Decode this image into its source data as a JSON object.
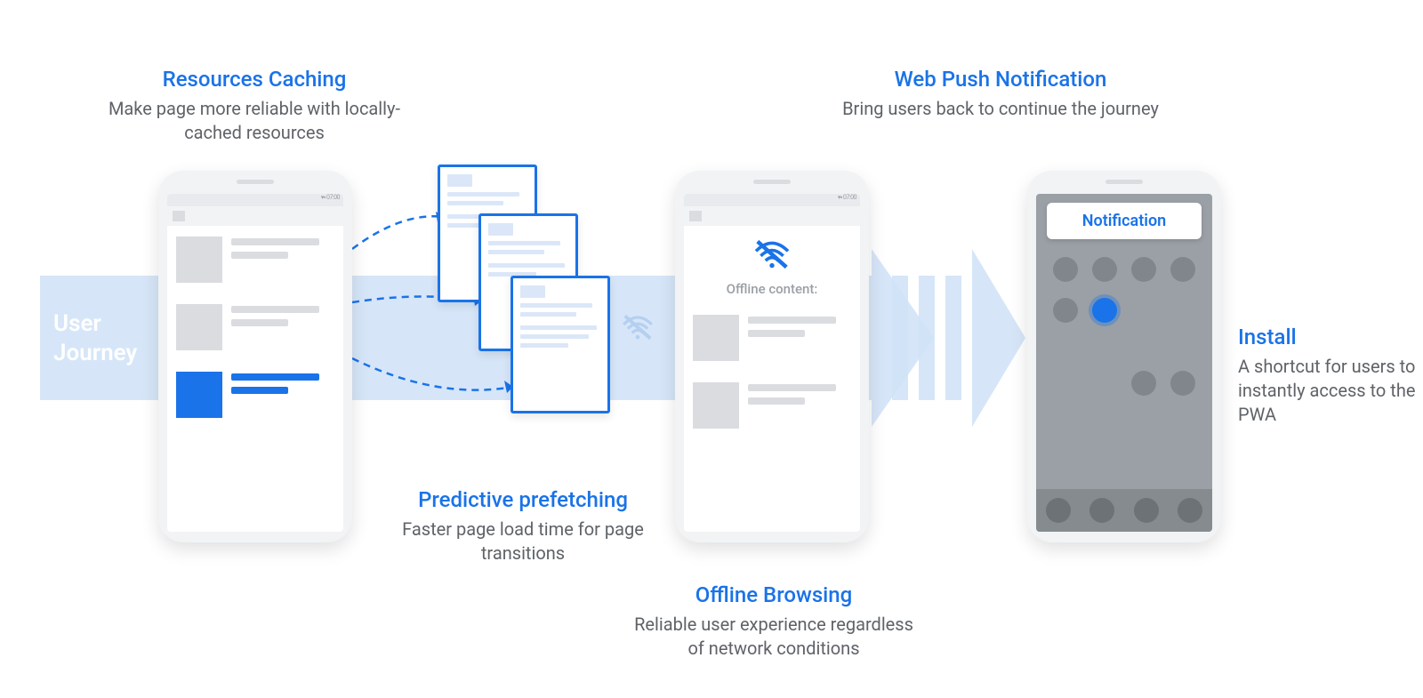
{
  "labels": {
    "user_journey": "User\nJourney",
    "caching": {
      "title": "Resources Caching",
      "desc": "Make page more reliable with locally-cached resources"
    },
    "prefetch": {
      "title": "Predictive prefetching",
      "desc": "Faster page load time for page transitions"
    },
    "offline": {
      "title": "Offline Browsing",
      "desc": "Reliable user experience regardless of network conditions"
    },
    "push": {
      "title": "Web Push Notification",
      "desc": "Bring users back to continue the journey"
    },
    "install": {
      "title": "Install",
      "desc": "A shortcut for users to instantly access to the PWA"
    }
  },
  "phone2": {
    "offline_content": "Offline content:"
  },
  "phone3": {
    "notification": "Notification"
  },
  "colors": {
    "accent": "#1a73e8",
    "band": "#cfe2f7",
    "muted": "#5f6368"
  }
}
